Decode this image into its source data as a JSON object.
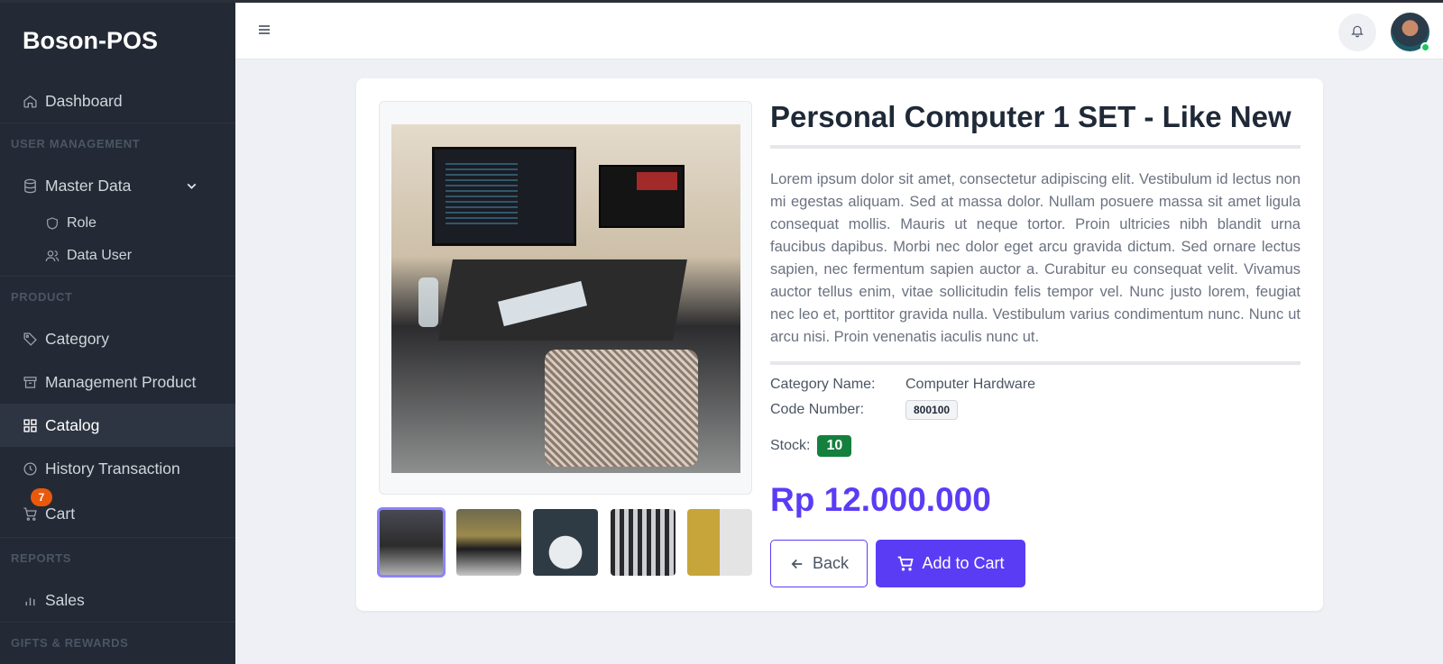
{
  "app": {
    "brand": "Boson-POS"
  },
  "sidebar": {
    "dashboard": "Dashboard",
    "section_user_management": "USER MANAGEMENT",
    "master_data": "Master Data",
    "role": "Role",
    "data_user": "Data User",
    "section_product": "PRODUCT",
    "category": "Category",
    "management_product": "Management Product",
    "catalog": "Catalog",
    "history_transaction": "History Transaction",
    "cart": "Cart",
    "cart_count": "7",
    "section_reports": "REPORTS",
    "sales": "Sales",
    "section_gifts": "GIFTS & REWARDS"
  },
  "product": {
    "title": "Personal Computer 1 SET - Like New",
    "description": "Lorem ipsum dolor sit amet, consectetur adipiscing elit. Vestibulum id lectus non mi egestas aliquam. Sed at massa dolor. Nullam posuere massa sit amet ligula consequat mollis. Mauris ut neque tortor. Proin ultricies nibh blandit urna faucibus dapibus. Morbi nec dolor eget arcu gravida dictum. Sed ornare lectus sapien, nec fermentum sapien auctor a. Curabitur eu consequat velit. Vivamus auctor tellus enim, vitae sollicitudin felis tempor vel. Nunc justo lorem, feugiat nec leo et, porttitor gravida nulla. Vestibulum varius condimentum nunc. Nunc ut arcu nisi. Proin venenatis iaculis nunc ut.",
    "category_label": "Category Name:",
    "category_value": "Computer Hardware",
    "code_label": "Code Number:",
    "code_value": "800100",
    "stock_label": "Stock:",
    "stock_value": "10",
    "price": "Rp 12.000.000",
    "back_label": "Back",
    "add_to_cart_label": "Add to Cart"
  },
  "colors": {
    "accent": "#5b3cf5",
    "sidebar_bg": "#232a35",
    "stock_badge": "#15803d",
    "cart_badge": "#ea580c"
  }
}
